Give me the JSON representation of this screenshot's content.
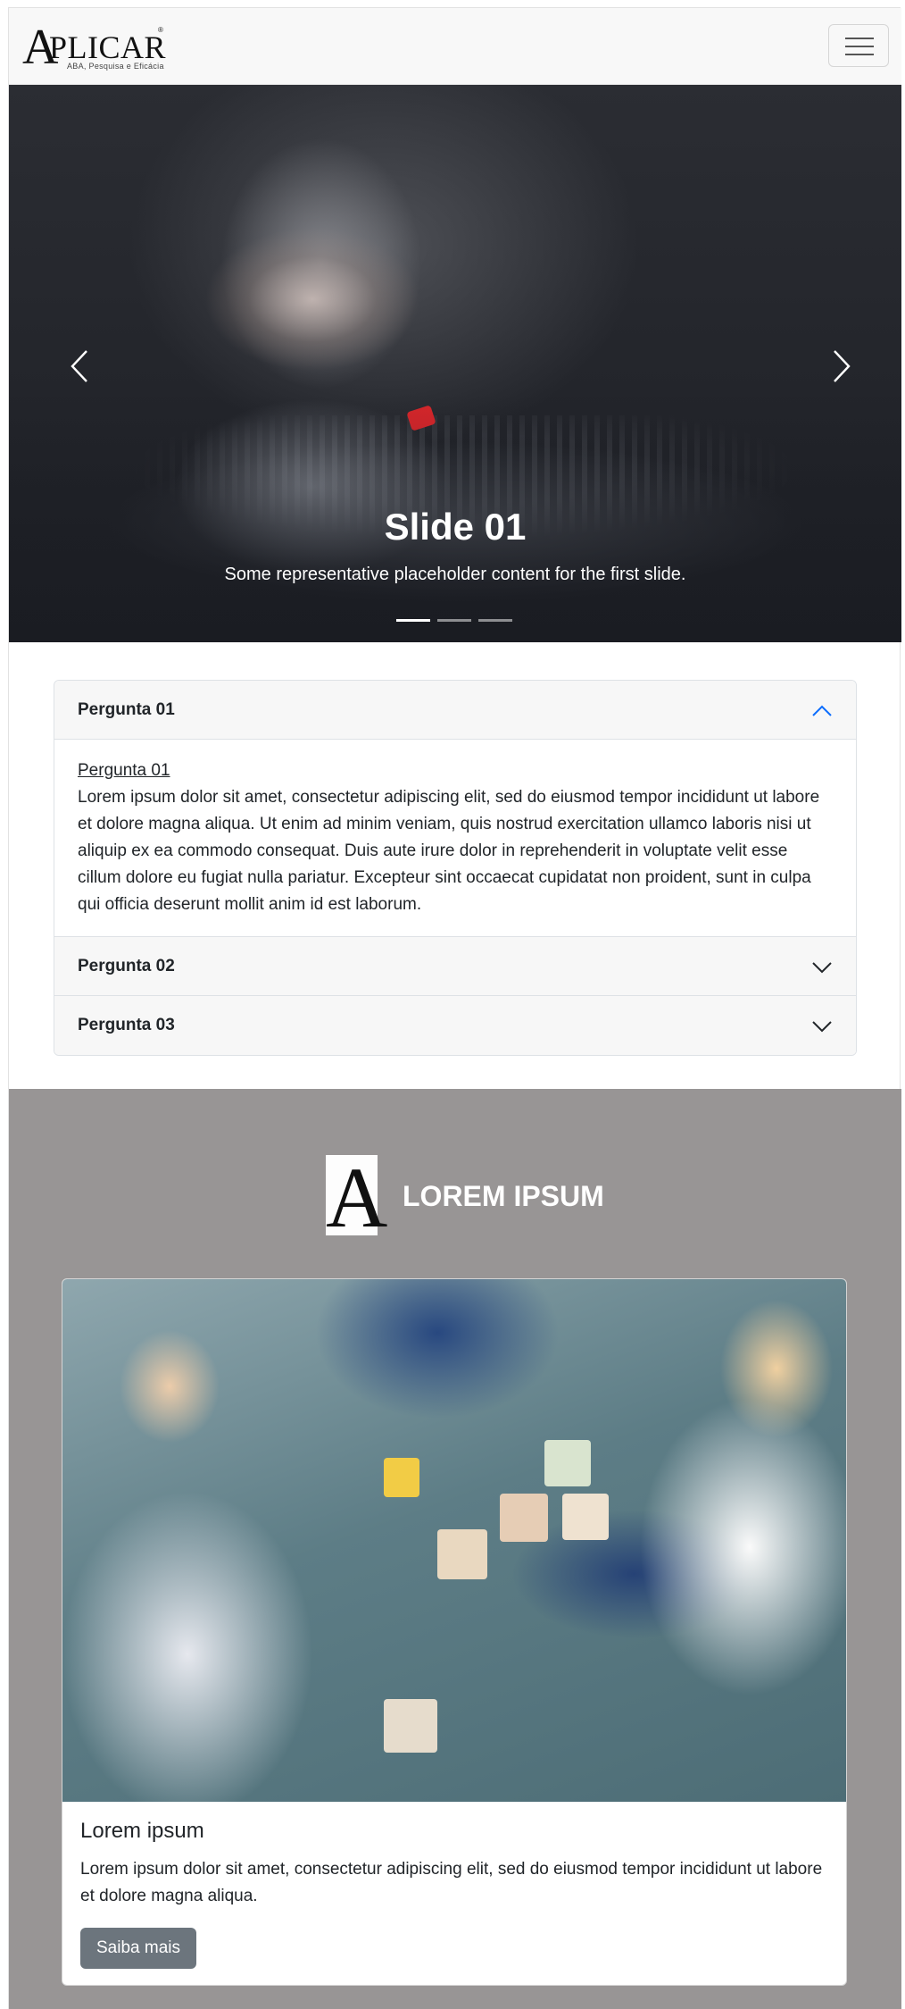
{
  "navbar": {
    "brand_initial": "A",
    "brand_word": "PLICAR",
    "brand_registered": "®",
    "brand_tagline": "ABA, Pesquisa e Eficácia",
    "menu_icon": "hamburger-icon"
  },
  "carousel": {
    "title": "Slide 01",
    "text": "Some representative placeholder content for the first slide.",
    "prev_icon": "chevron-left-icon",
    "next_icon": "chevron-right-icon",
    "indicators": [
      {
        "active": true
      },
      {
        "active": false
      },
      {
        "active": false
      }
    ]
  },
  "accordion": {
    "items": [
      {
        "title": "Pergunta 01",
        "expanded": true,
        "body_title": "Pergunta 01",
        "body_text": "Lorem ipsum dolor sit amet, consectetur adipiscing elit, sed do eiusmod tempor incididunt ut labore et dolore magna aliqua. Ut enim ad minim veniam, quis nostrud exercitation ullamco laboris nisi ut aliquip ex ea commodo consequat. Duis aute irure dolor in reprehenderit in voluptate velit esse cillum dolore eu fugiat nulla pariatur. Excepteur sint occaecat cupidatat non proident, sunt in culpa qui officia deserunt mollit anim id est laborum."
      },
      {
        "title": "Pergunta 02",
        "expanded": false
      },
      {
        "title": "Pergunta 03",
        "expanded": false
      }
    ]
  },
  "section": {
    "logo_letter": "A",
    "title": "LOREM IPSUM",
    "background_color": "#989595"
  },
  "card": {
    "title": "Lorem ipsum",
    "text": "Lorem ipsum dolor sit amet, consectetur adipiscing elit, sed do eiusmod tempor incididunt ut labore et dolore magna aliqua.",
    "button_label": "Saiba mais",
    "button_color": "#6c757d"
  },
  "colors": {
    "accordion_active_chevron": "#0d6efd",
    "chevron": "#212529"
  }
}
